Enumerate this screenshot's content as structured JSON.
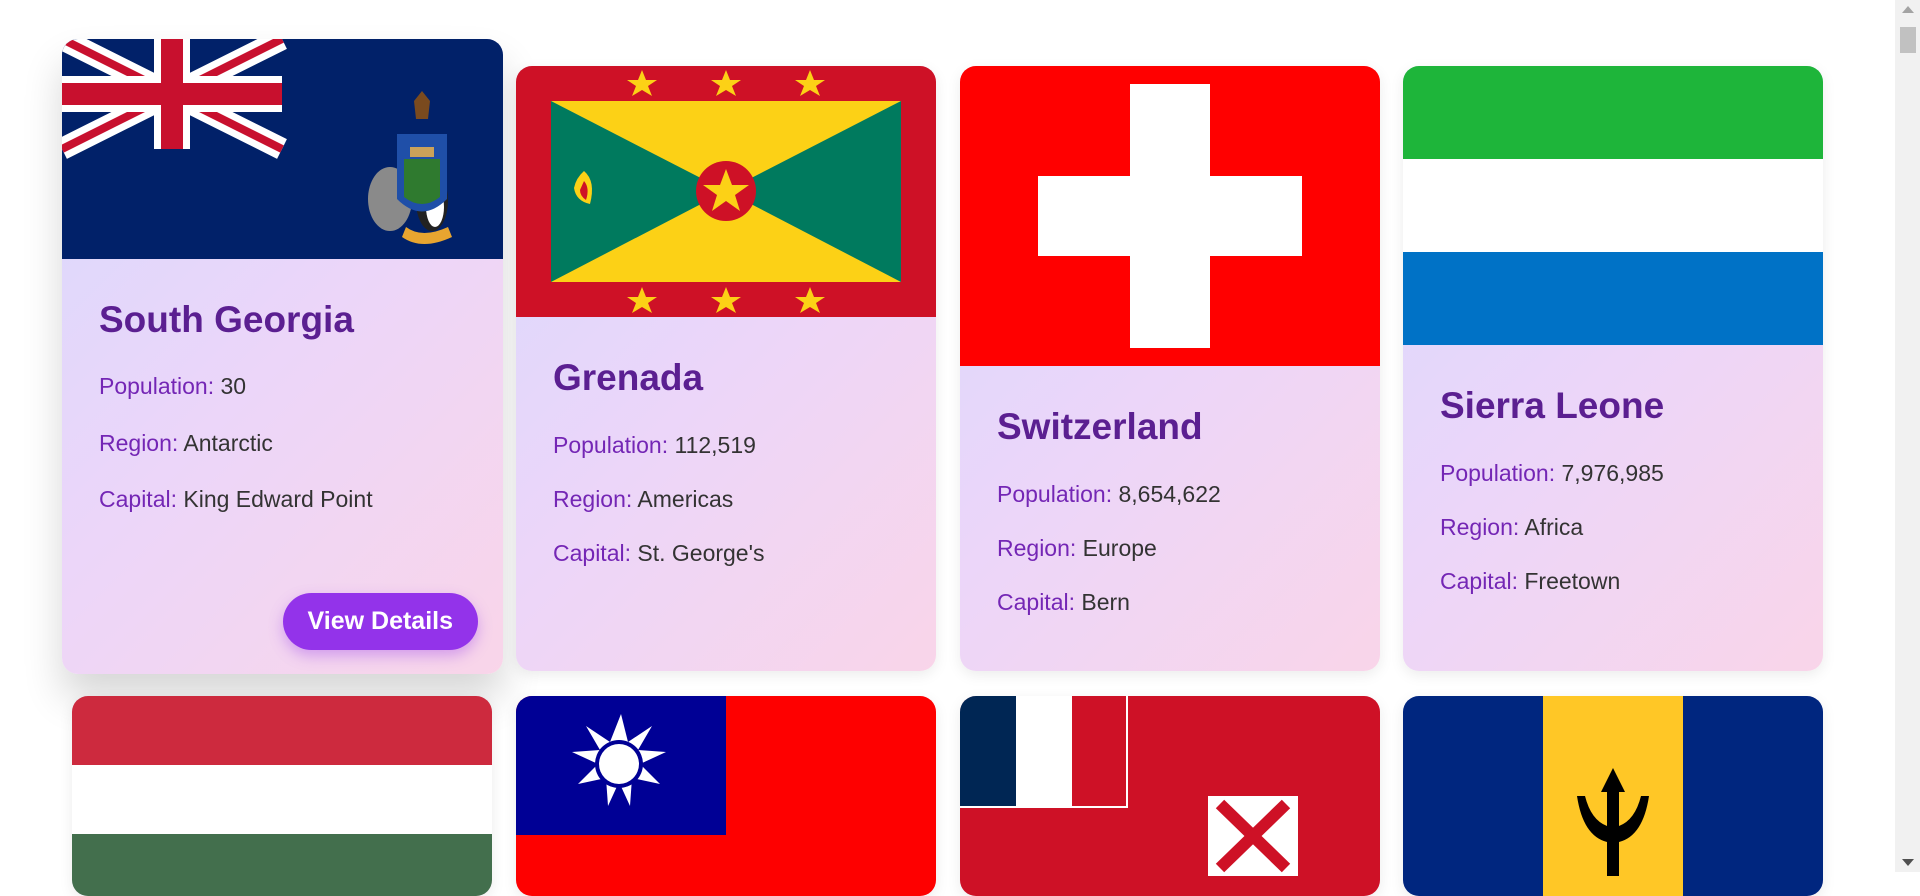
{
  "details_button_label": "View Details",
  "labels": {
    "population": "Population:",
    "region": "Region:",
    "capital": "Capital:"
  },
  "countries": [
    {
      "name": "South Georgia",
      "population": "30",
      "region": "Antarctic",
      "capital": "King Edward Point",
      "flag_icon": "south-georgia-flag-icon"
    },
    {
      "name": "Grenada",
      "population": "112,519",
      "region": "Americas",
      "capital": "St. George's",
      "flag_icon": "grenada-flag-icon"
    },
    {
      "name": "Switzerland",
      "population": "8,654,622",
      "region": "Europe",
      "capital": "Bern",
      "flag_icon": "switzerland-flag-icon"
    },
    {
      "name": "Sierra Leone",
      "population": "7,976,985",
      "region": "Africa",
      "capital": "Freetown",
      "flag_icon": "sierra-leone-flag-icon"
    },
    {
      "flag_icon": "hungary-flag-icon"
    },
    {
      "flag_icon": "taiwan-flag-icon"
    },
    {
      "flag_icon": "wallis-and-futuna-flag-icon"
    },
    {
      "flag_icon": "barbados-flag-icon"
    }
  ],
  "colors": {
    "title": "#5b1f91",
    "label": "#7426b5",
    "button": "#9333ea"
  }
}
